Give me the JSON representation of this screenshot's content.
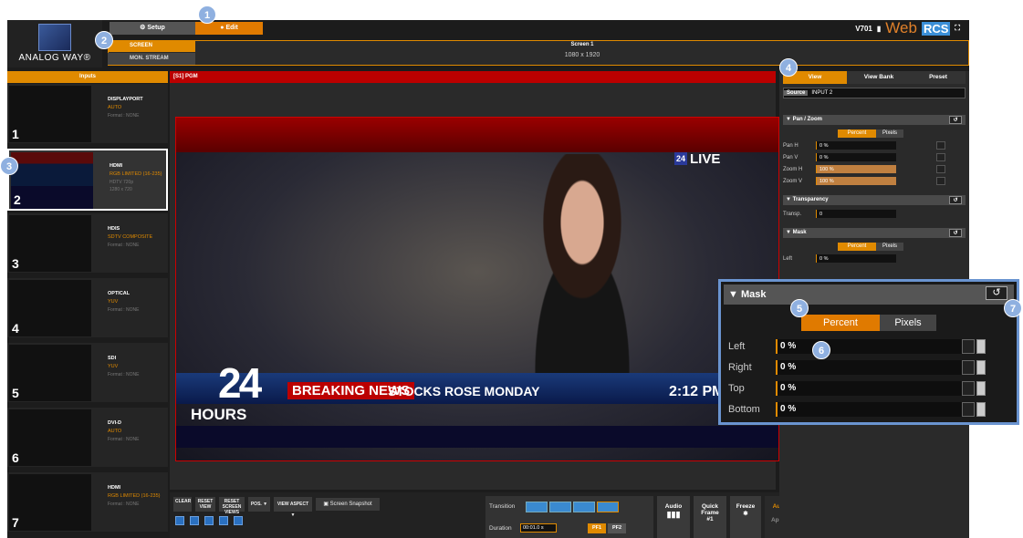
{
  "header": {
    "setup": "Setup",
    "edit": "Edit",
    "version": "V701",
    "brand_web": "Web",
    "brand_rcs": "RCS",
    "logo_text": "ANALOG WAY®"
  },
  "screen_tabs": {
    "screen": "SCREEN",
    "mon_stream": "MON. STREAM",
    "screen_title": "Screen 1",
    "screen_res": "1080 x 1920"
  },
  "inputs": {
    "header": "Inputs",
    "items": [
      {
        "num": "1",
        "name": "DISPLAYPORT",
        "sub": "AUTO",
        "fmt": "Format : NONE"
      },
      {
        "num": "2",
        "name": "HDMI",
        "sub": "RGB LIMITED (16-235)",
        "fmt": "HDTV 720p",
        "fmt2": "1280 x 720"
      },
      {
        "num": "3",
        "name": "HDIS",
        "sub": "SDTV COMPOSITE",
        "fmt": "Format : NONE"
      },
      {
        "num": "4",
        "name": "OPTICAL",
        "sub": "YUV",
        "fmt": "Format : NONE"
      },
      {
        "num": "5",
        "name": "SDI",
        "sub": "YUV",
        "fmt": "Format : NONE"
      },
      {
        "num": "6",
        "name": "DVI-D",
        "sub": "AUTO",
        "fmt": "Format : NONE"
      },
      {
        "num": "7",
        "name": "HDMI",
        "sub": "RGB LIMITED (16-235)",
        "fmt": "Format : NONE"
      }
    ]
  },
  "program": {
    "header": "[S1] PGM",
    "live": "LIVE",
    "live_badge": "24",
    "n24": "24",
    "hours": "HOURS",
    "breaking": "BREAKING NEWS",
    "stocks": "STOCKS ROSE MONDAY",
    "clock": "2:12 PM"
  },
  "toolbar": {
    "clear": "CLEAR",
    "reset_view": "RESET VIEW",
    "reset_screen": "RESET SCREEN VIEWS",
    "pos": "POS. ▼",
    "view_aspect": "VIEW ASPECT ▼",
    "snapshot": "Screen Snapshot",
    "transition": "Transition",
    "duration": "Duration",
    "duration_value": "00:01.0 s",
    "pf1": "PF1",
    "pf2": "PF2",
    "audio": "Audio",
    "quick_frame": "Quick Frame",
    "quick_num": "#1",
    "freeze": "Freeze",
    "auto": "Auto",
    "apply": "Apply"
  },
  "right": {
    "tab_view": "View",
    "tab_view_bank": "View Bank",
    "tab_preset": "Preset",
    "source_label": "Source",
    "source_value": "INPUT 2",
    "pan_zoom": "▼ Pan / Zoom",
    "percent": "Percent",
    "pixels": "Pixels",
    "pan_h": "Pan H",
    "pan_h_v": "0 %",
    "pan_v": "Pan V",
    "pan_v_v": "0 %",
    "zoom_h": "Zoom H",
    "zoom_h_v": "100 %",
    "zoom_v": "Zoom V",
    "zoom_v_v": "100 %",
    "transparency": "▼ Transparency",
    "transp": "Transp.",
    "transp_v": "0",
    "mask": "▼ Mask",
    "left": "Left",
    "left_v": "0 %"
  },
  "callout": {
    "title": "▼ Mask",
    "percent": "Percent",
    "pixels": "Pixels",
    "rows": [
      {
        "label": "Left",
        "value": "0 %"
      },
      {
        "label": "Right",
        "value": "0 %"
      },
      {
        "label": "Top",
        "value": "0 %"
      },
      {
        "label": "Bottom",
        "value": "0 %"
      }
    ]
  },
  "badges": [
    "1",
    "2",
    "3",
    "4",
    "5",
    "6",
    "7"
  ],
  "colors": {
    "accent": "#e08a00",
    "pgm_red": "#bb0000",
    "callout_border": "#6a94d0"
  },
  "levels": {
    "pan_h": 0,
    "pan_v": 0,
    "zoom_h": 100,
    "zoom_v": 100
  }
}
